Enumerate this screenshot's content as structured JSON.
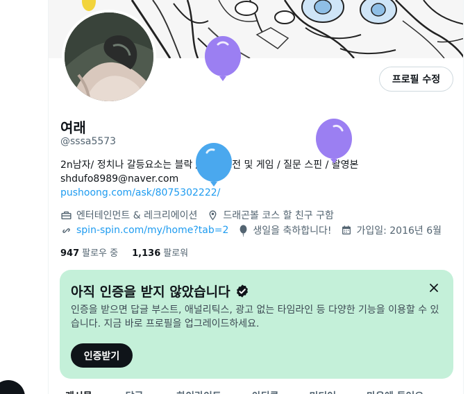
{
  "profile": {
    "display_name": "여래",
    "handle": "@sssa5573",
    "edit_button": "프로필 수정",
    "bio_line1": "2n남자/ 정치나 갈등요소는 블락 / 본진 고전 및 게임 / 질문 스핀 / 촬영본",
    "bio_line2": "shdufo8989@naver.com",
    "bio_link": "pushoong.com/ask/8075302222/"
  },
  "meta": {
    "category": "엔터테인먼트 & 레크리에이션",
    "location": "드래곤볼 코스 할 친구 구함",
    "website": "spin-spin.com/my/home?tab=2",
    "birthday": "생일을 축하합니다!",
    "joined": "가입일: 2016년 6월"
  },
  "stats": {
    "following_count": "947",
    "following_label": "팔로우 중",
    "followers_count": "1,136",
    "followers_label": "팔로워"
  },
  "verify": {
    "title": "아직 인증을 받지 않았습니다",
    "body": "인증을 받으면 답글 부스트, 애널리틱스, 광고 없는 타임라인 등 다양한 기능을 이용할 수 있습니다. 지금 바로 프로필을 업그레이드하세요.",
    "button": "인증받기"
  },
  "tabs": [
    "게시물",
    "답글",
    "하이라이트",
    "아티클",
    "미디어",
    "마음에 들어요"
  ],
  "colors": {
    "accent": "#1d9bf0",
    "verify_bg": "#c4f0d9",
    "balloon_purple": "#9b7ff2",
    "balloon_blue": "#4aa8ee"
  },
  "icons": [
    "briefcase-icon",
    "location-icon",
    "link-icon",
    "balloon-icon",
    "calendar-icon",
    "verified-badge-icon",
    "close-icon"
  ]
}
